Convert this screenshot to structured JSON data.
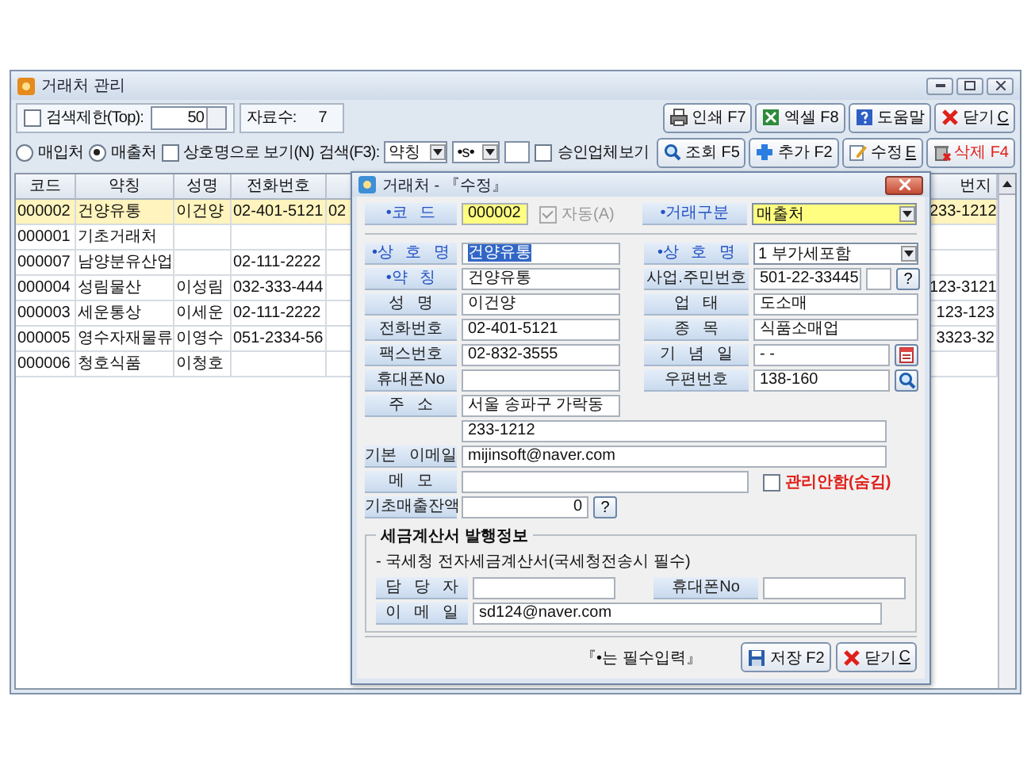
{
  "window": {
    "title": "거래처 관리"
  },
  "toolbar": {
    "limit": {
      "label": "검색제한(Top):",
      "checked": false,
      "value": "50"
    },
    "count_label": "자료수:",
    "count": "7",
    "buttons": [
      {
        "label": "인쇄 F7",
        "mnemonic": false,
        "danger": false
      },
      {
        "label": "엑셀 F8",
        "mnemonic": false,
        "danger": false
      },
      {
        "label": "도움말",
        "mnemonic": false,
        "danger": false
      },
      {
        "label": "닫기 C",
        "mnemonic": true,
        "danger": false
      }
    ]
  },
  "filter": {
    "radios": [
      {
        "label": "매입처",
        "selected": false
      },
      {
        "label": "매출처",
        "selected": true
      }
    ],
    "name_view": {
      "label": "상호명으로 보기(N)",
      "checked": false
    },
    "search_label": "검색(F3):",
    "search_field": "약칭",
    "search_mode": "•s•",
    "approved_view": {
      "label": "승인업체보기",
      "checked": false
    },
    "buttons": [
      {
        "label": "조회 F5",
        "mnemonic": false,
        "danger": false
      },
      {
        "label": "추가 F2",
        "mnemonic": false,
        "danger": false
      },
      {
        "label": "수정 E",
        "mnemonic": true,
        "danger": false
      },
      {
        "label": "삭제 F4",
        "mnemonic": false,
        "danger": true
      }
    ]
  },
  "table": {
    "columns": [
      "코드",
      "약칭",
      "성명",
      "전화번호",
      "번지"
    ],
    "rows": [
      {
        "selected": true,
        "code": "000002",
        "name": "건양유통",
        "person": "이건양",
        "phone": "02-401-5121",
        "column_5": "02",
        "lot": "233-1212"
      },
      {
        "selected": false,
        "code": "000001",
        "name": "기초거래처"
      },
      {
        "selected": false,
        "code": "000007",
        "name": "남양분유산업",
        "phone": "02-111-2222"
      },
      {
        "selected": false,
        "code": "000004",
        "name": "성림물산",
        "person": "이성림",
        "phone": "032-333-444",
        "lot": "123-3121"
      },
      {
        "selected": false,
        "code": "000003",
        "name": "세운통상",
        "person": "이세운",
        "phone": "02-111-2222",
        "lot": "123-123"
      },
      {
        "selected": false,
        "code": "000005",
        "name": "영수자재물류",
        "person": "이영수",
        "phone": "051-2334-56",
        "lot": "3323-32"
      },
      {
        "selected": false,
        "code": "000006",
        "name": "청호식품",
        "person": "이청호"
      }
    ]
  },
  "dialog": {
    "title": "거래처 - 『수정』",
    "code": {
      "label": "•코 드",
      "required": true,
      "value": "000002"
    },
    "auto": {
      "label": "자동(A)",
      "checked": true,
      "disabled": true
    },
    "trade_type": {
      "label": "•거래구분",
      "required": true,
      "value": "매출처"
    },
    "rows": [
      {
        "left": {
          "label": "•상 호 명",
          "required": true,
          "value": "건양유통",
          "text_selected": true
        },
        "right": {
          "kind": "dropdown",
          "label": "•상 호 명",
          "required": true,
          "value": "1 부가세포함"
        }
      },
      {
        "left": {
          "label": "•약 칭",
          "required": true,
          "value": "건양유통",
          "text_selected": false
        },
        "right": {
          "kind": "id",
          "label": "사업.주민번호",
          "required": false,
          "value": "501-22-33445",
          "button": "?"
        }
      },
      {
        "left": {
          "label": "성 명",
          "required": false,
          "value": "이건양",
          "text_selected": false
        },
        "right": {
          "kind": "text",
          "label": "업 태",
          "required": false,
          "value": "도소매"
        }
      },
      {
        "left": {
          "label": "전화번호",
          "required": false,
          "value": "02-401-5121",
          "text_selected": false
        },
        "right": {
          "kind": "text",
          "label": "종 목",
          "required": false,
          "value": "식품소매업"
        }
      },
      {
        "left": {
          "label": "팩스번호",
          "required": false,
          "value": "02-832-3555",
          "text_selected": false
        },
        "right": {
          "kind": "date",
          "label": "기 념 일",
          "required": false,
          "value": "-  -"
        }
      },
      {
        "left": {
          "label": "휴대폰No",
          "required": false
        },
        "right": {
          "kind": "zip",
          "label": "우편번호",
          "required": false,
          "value": "138-160"
        }
      }
    ],
    "address": {
      "label": "주 소",
      "value": "서울 송파구 가락동",
      "line2": "233-1212"
    },
    "email": {
      "label": "기본 이메일",
      "value": "mijinsoft@naver.com"
    },
    "memo": {
      "label": "메 모"
    },
    "hide": {
      "label": "관리안함(숨김)",
      "checked": false
    },
    "balance": {
      "label": "기초매출잔액",
      "value": "0",
      "button": "?"
    },
    "tax_invoice": {
      "title": "세금계산서 발행정보",
      "note": "- 국세청 전자세금계산서(국세청전송시 필수)",
      "manager": {
        "label": "담 당 자"
      },
      "mobile": {
        "label": "휴대폰No"
      },
      "email": {
        "label": "이 메 일",
        "value": "sd124@naver.com"
      }
    },
    "footnote": "『•는 필수입력』",
    "buttons": [
      {
        "label": "저장 F2",
        "mnemonic": false,
        "danger": false
      },
      {
        "label": "닫기 C",
        "mnemonic": true,
        "danger": false
      }
    ]
  }
}
